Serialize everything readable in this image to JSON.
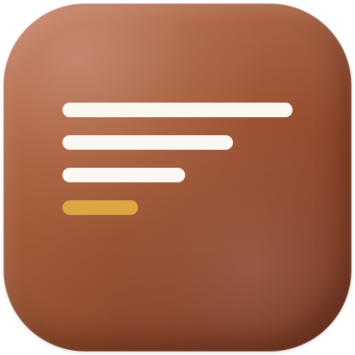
{
  "icon": {
    "name": "document-lines-app-icon",
    "colors": {
      "background": "#a55a38",
      "background_dark": "#7a3b24",
      "line_light": "#fcf7f1",
      "line_accent": "#dea643"
    },
    "bars": [
      {
        "name": "text-line-1",
        "color": "#fcf7f1"
      },
      {
        "name": "text-line-2",
        "color": "#fcf7f1"
      },
      {
        "name": "text-line-3",
        "color": "#fcf7f1"
      },
      {
        "name": "accent-line",
        "color": "#dea643"
      }
    ]
  }
}
